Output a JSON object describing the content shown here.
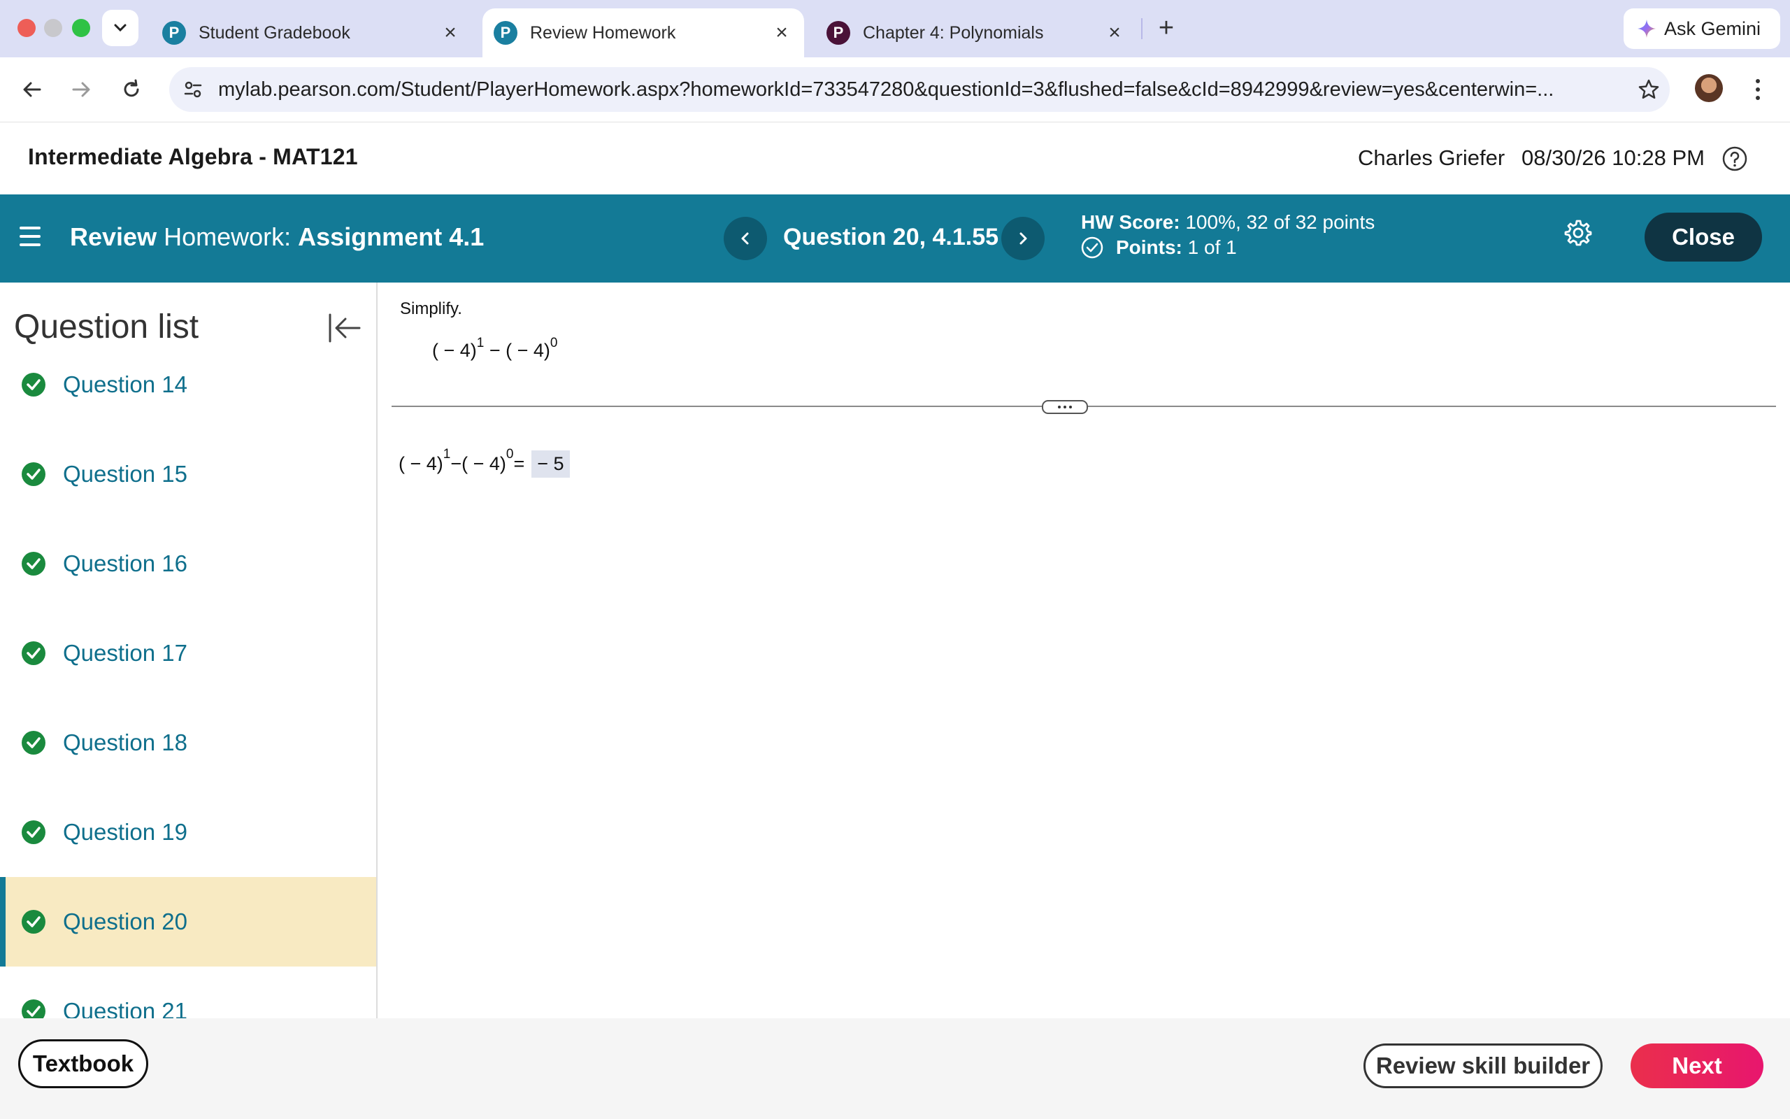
{
  "browser": {
    "tabs": [
      {
        "title": "Student Gradebook",
        "favicon": "P",
        "favicon_color": "#1a7fa0",
        "active": false
      },
      {
        "title": "Review Homework",
        "favicon": "P",
        "favicon_color": "#1a7fa0",
        "active": true
      },
      {
        "title": "Chapter 4: Polynomials",
        "favicon": "P",
        "favicon_color": "#4a1238",
        "active": false
      }
    ],
    "close_glyph": "×",
    "new_tab_glyph": "+",
    "gemini_label": "Ask Gemini",
    "url": "mylab.pearson.com/Student/PlayerHomework.aspx?homeworkId=733547280&questionId=3&flushed=false&cId=8942999&review=yes&centerwin=..."
  },
  "course": {
    "title": "Intermediate Algebra - MAT121",
    "user": "Charles Griefer",
    "datetime": "08/30/26 10:28 PM"
  },
  "assignment": {
    "title_bold": "Review",
    "title_regular": "Homework:",
    "name": "Assignment 4.1",
    "question_label": "Question 20, 4.1.55",
    "hw_score_label": "HW Score:",
    "hw_score_value": "100%, 32 of 32 points",
    "points_label": "Points:",
    "points_value": "1 of 1",
    "close_label": "Close"
  },
  "sidebar": {
    "title": "Question list",
    "items": [
      {
        "label": "Question 14"
      },
      {
        "label": "Question 15"
      },
      {
        "label": "Question 16"
      },
      {
        "label": "Question 17"
      },
      {
        "label": "Question 18"
      },
      {
        "label": "Question 19"
      },
      {
        "label": "Question 20",
        "selected": true
      },
      {
        "label": "Question 21"
      }
    ]
  },
  "question": {
    "instruction": "Simplify.",
    "expr_base1": "( − 4)",
    "exp1": "1",
    "minus": " − ",
    "expr_base2": "( − 4)",
    "exp2": "0",
    "equals": " = ",
    "answer": "− 5"
  },
  "footer": {
    "textbook_label": "Textbook",
    "review_label": "Review skill builder",
    "next_label": "Next"
  },
  "colors": {
    "teal": "#137a96",
    "check_green": "#1a8a3e",
    "selected_bg": "#f8eac2",
    "next_red": "#ea2f4c"
  }
}
